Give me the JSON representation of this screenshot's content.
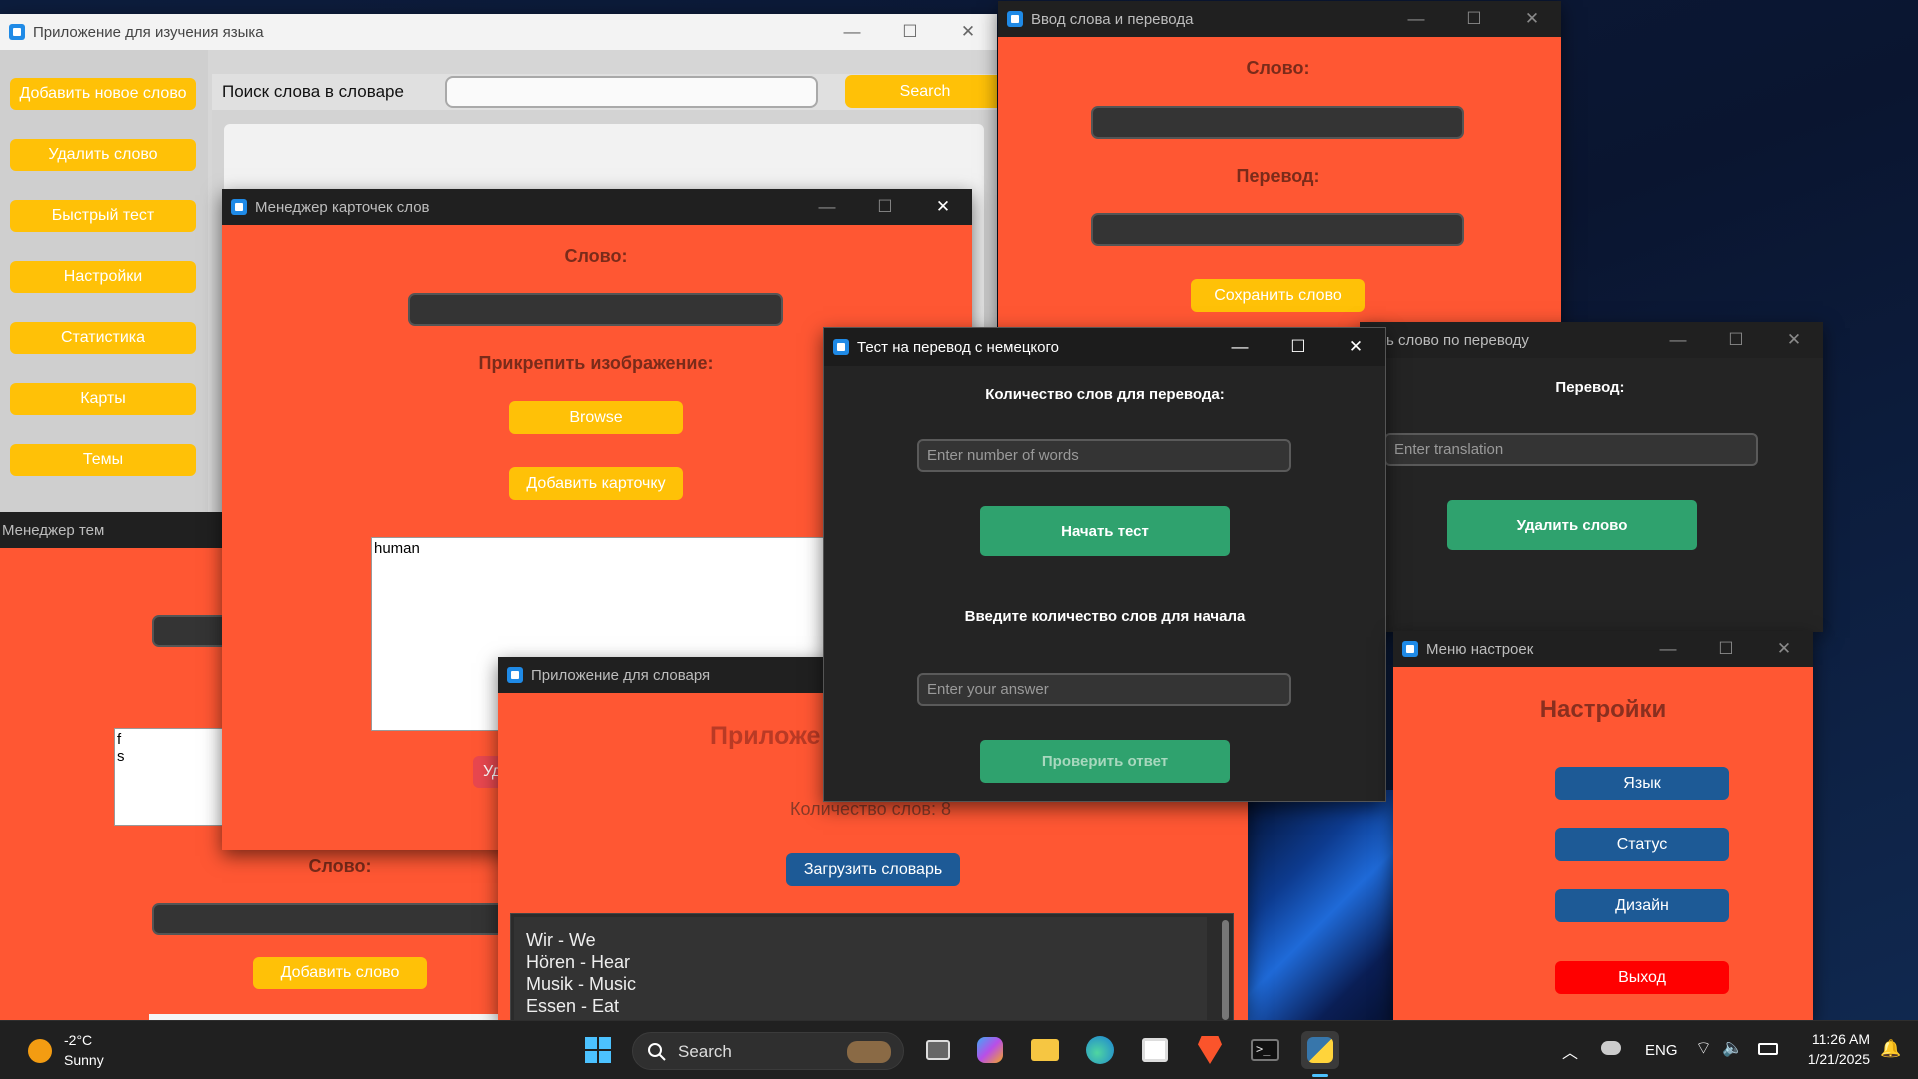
{
  "main_app": {
    "title": "Приложение для изучения языка",
    "sidebar": [
      "Добавить новое слово",
      "Удалить слово",
      "Быстрый тест",
      "Настройки",
      "Статистика",
      "Карты",
      "Темы"
    ],
    "search_label": "Поиск слова в словаре",
    "search_value": "",
    "search_button": "Search"
  },
  "themes_manager": {
    "title": "Менеджер тем",
    "textbox_lines": [
      "f",
      "s"
    ],
    "word_label": "Слово:",
    "add_button": "Добавить слово"
  },
  "card_manager": {
    "title": "Менеджер карточек слов",
    "word_label": "Слово:",
    "attach_label": "Прикрепить изображение:",
    "browse_button": "Browse",
    "add_card_button": "Добавить карточку",
    "text_content": "human",
    "partial_button": "Уд"
  },
  "word_entry": {
    "title": "Ввод слова и перевода",
    "word_label": "Слово:",
    "translation_label": "Перевод:",
    "save_button": "Сохранить слово"
  },
  "delete_by_translation": {
    "title": "лить слово по переводу",
    "translation_label": "Перевод:",
    "placeholder": "Enter translation",
    "delete_button": "Удалить слово"
  },
  "dictionary_app": {
    "title": "Приложение для словаря",
    "heading": "Приложе",
    "count_text": "Количество слов:  8",
    "load_button": "Загрузить словарь",
    "entries": [
      "Wir - We",
      "Hören - Hear",
      "Musik - Music",
      "Essen - Eat"
    ]
  },
  "test_window": {
    "title": "Тест на перевод с немецкого",
    "count_label": "Количество слов для перевода:",
    "count_placeholder": "Enter number of words",
    "start_button": "Начать тест",
    "prompt_label": "Введите количество слов для начала",
    "answer_placeholder": "Enter your answer",
    "check_button": "Проверить ответ"
  },
  "settings_menu": {
    "title": "Меню настроек",
    "heading": "Настройки",
    "buttons": [
      "Язык",
      "Статус",
      "Дизайн"
    ],
    "exit_button": "Выход"
  },
  "taskbar": {
    "weather_temp": "-2°C",
    "weather_desc": "Sunny",
    "search_text": "Search",
    "language": "ENG",
    "time": "11:26 AM",
    "date": "1/21/2025"
  },
  "colors": {
    "orange_bg": "#ff5733",
    "yellow_button": "#ffc107",
    "green_button": "#2fa26e",
    "blue_button": "#1d5a96",
    "exit_red": "#ff0000",
    "dark_window": "#242424"
  }
}
